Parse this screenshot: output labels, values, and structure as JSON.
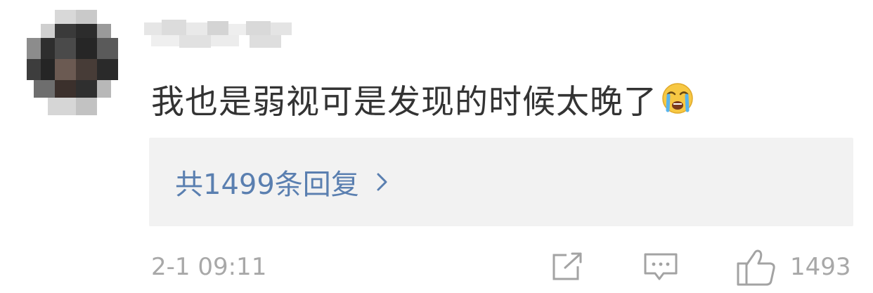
{
  "comment": {
    "text": "我也是弱视可是发现的时候太晚了",
    "emoji": "crying-face-emoji",
    "replies_label": "共1499条回复",
    "timestamp": "2-1 09:11",
    "like_count": "1493"
  },
  "colors": {
    "text": "#333333",
    "link": "#5a7fb0",
    "meta": "#a8a8a8",
    "reply_bg": "#f2f2f2"
  }
}
